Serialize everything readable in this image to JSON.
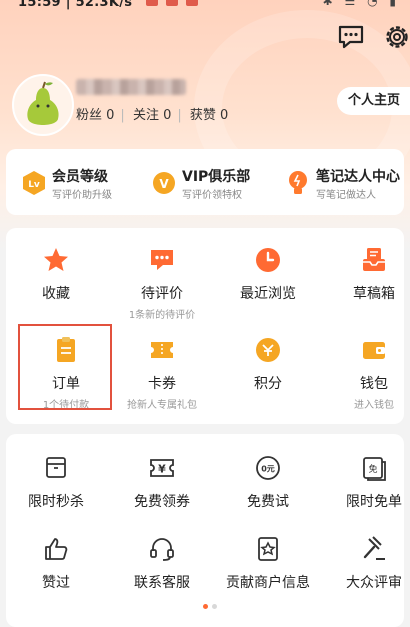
{
  "status_bar": {
    "time": "15:59 | 52.3K/s",
    "right": "✱ ☰ ◔ ▮"
  },
  "profile": {
    "stats": {
      "fans": "粉丝 0",
      "following": "关注 0",
      "likes": "获赞 0"
    },
    "home_button": "个人主页"
  },
  "vip_row": [
    {
      "title": "会员等级",
      "sub": "写评价助升级",
      "badge": "Lv"
    },
    {
      "title": "VIP俱乐部",
      "sub": "写评价领特权",
      "badge": "V"
    },
    {
      "title": "笔记达人中心",
      "sub": "写笔记做达人"
    }
  ],
  "grid": [
    {
      "label": "收藏",
      "sub": ""
    },
    {
      "label": "待评价",
      "sub": "1条新的待评价"
    },
    {
      "label": "最近浏览",
      "sub": ""
    },
    {
      "label": "草稿箱",
      "sub": ""
    },
    {
      "label": "订单",
      "sub": "1个待付款"
    },
    {
      "label": "卡券",
      "sub": "抢新人专属礼包"
    },
    {
      "label": "积分",
      "sub": ""
    },
    {
      "label": "钱包",
      "sub": "进入钱包"
    }
  ],
  "tools": [
    {
      "label": "限时秒杀",
      "glyph": ""
    },
    {
      "label": "免费领券",
      "glyph": "¥"
    },
    {
      "label": "免费试",
      "glyph": "0元"
    },
    {
      "label": "限时免单",
      "glyph": "免"
    },
    {
      "label": "赞过",
      "glyph": ""
    },
    {
      "label": "联系客服",
      "glyph": ""
    },
    {
      "label": "贡献商户信息",
      "glyph": ""
    },
    {
      "label": "大众评审",
      "glyph": ""
    }
  ],
  "colors": {
    "accent": "#ff6a33",
    "highlight": "#e2513d",
    "vip_gold": "#f5a623"
  }
}
